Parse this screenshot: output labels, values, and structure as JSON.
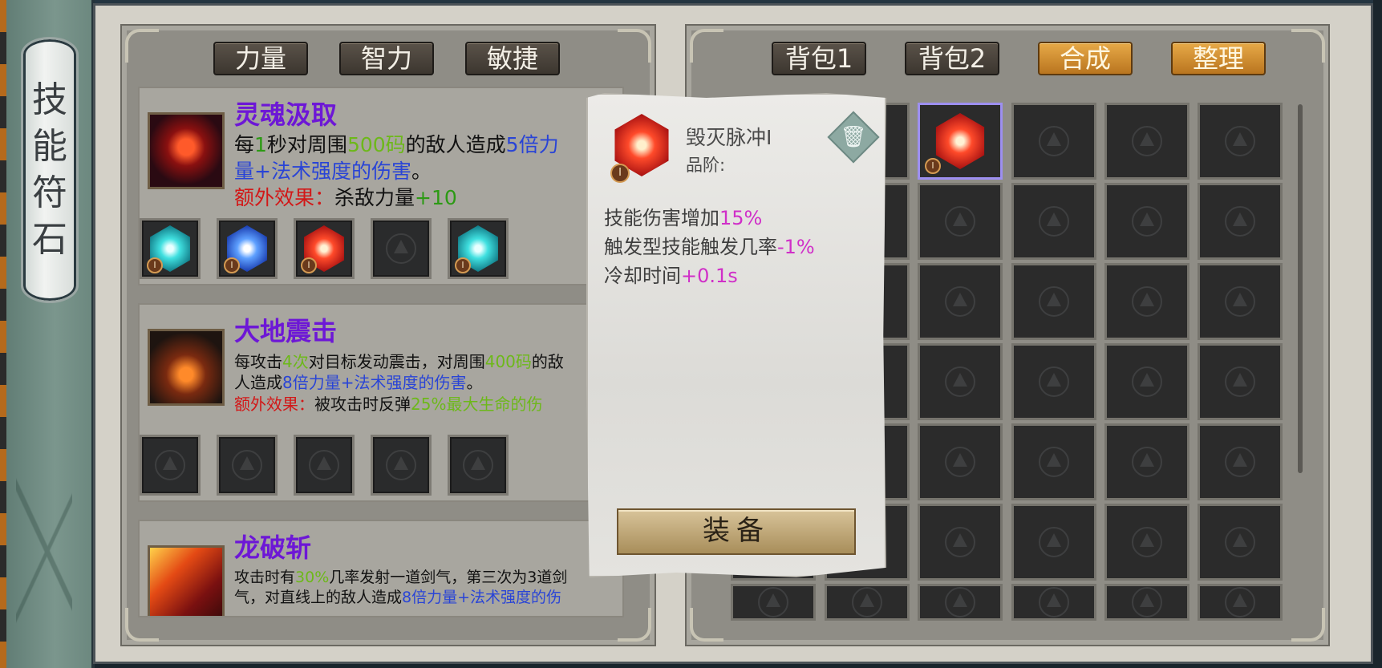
{
  "sidebar": {
    "title_chars": [
      "技",
      "能",
      "符",
      "石"
    ]
  },
  "left_tabs": [
    "力量",
    "智力",
    "敏捷"
  ],
  "right_tabs": [
    "背包1",
    "背包2",
    "合成",
    "整理"
  ],
  "skills": [
    {
      "name": "灵魂汲取",
      "desc": [
        "每",
        "1",
        "秒对周围",
        "500码",
        "的敌人造成",
        "5倍力",
        "量+法术强度的伤害",
        "。"
      ],
      "extra_label": "额外效果：",
      "extra_text": "杀敌力量",
      "extra_value": "+10",
      "gems": [
        {
          "color": "cyan",
          "grade": "I"
        },
        {
          "color": "blue",
          "grade": "I"
        },
        {
          "color": "red",
          "grade": "I"
        },
        {
          "color": "empty",
          "grade": ""
        },
        {
          "color": "cyan",
          "grade": "I"
        }
      ]
    },
    {
      "name": "大地震击",
      "desc": [
        "每攻击",
        "4次",
        "对目标发动震击，对周围",
        "400码",
        "的敌",
        "人造成",
        "8倍力量+法术强度的伤害",
        "。"
      ],
      "extra_label": "额外效果：",
      "extra_text": "被攻击时反弹",
      "extra_value": "25%最大生命的伤",
      "gems": [
        {
          "color": "empty",
          "grade": ""
        },
        {
          "color": "empty",
          "grade": ""
        },
        {
          "color": "empty",
          "grade": ""
        },
        {
          "color": "empty",
          "grade": ""
        },
        {
          "color": "empty",
          "grade": ""
        }
      ]
    },
    {
      "name": "龙破斩",
      "desc": [
        "攻击时有",
        "30%",
        "几率发射一道剑气，第三次为3道剑",
        "气，对直线上的敌人造成",
        "8倍力量+法术强度的伤"
      ]
    }
  ],
  "inventory": {
    "selected_item": {
      "color": "red",
      "grade": "I"
    }
  },
  "tooltip": {
    "item_name": "毁灭脉冲I",
    "grade_label": "品阶:",
    "grade_badge": "I",
    "trash_icon": "trash-icon",
    "stats": [
      {
        "label": "技能伤害增加",
        "value": "15%"
      },
      {
        "label": "触发型技能触发几率",
        "value": "-1%"
      },
      {
        "label": "冷却时间",
        "value": "+0.1s"
      }
    ],
    "equip_label": "装备"
  },
  "colors": {
    "accent_gold": "#e7a947",
    "skill_name": "#6d17d6",
    "highlight_green": "#2c9a14",
    "highlight_blue": "#2944d6",
    "highlight_red": "#d21818",
    "stat_magenta": "#d02fc8"
  }
}
